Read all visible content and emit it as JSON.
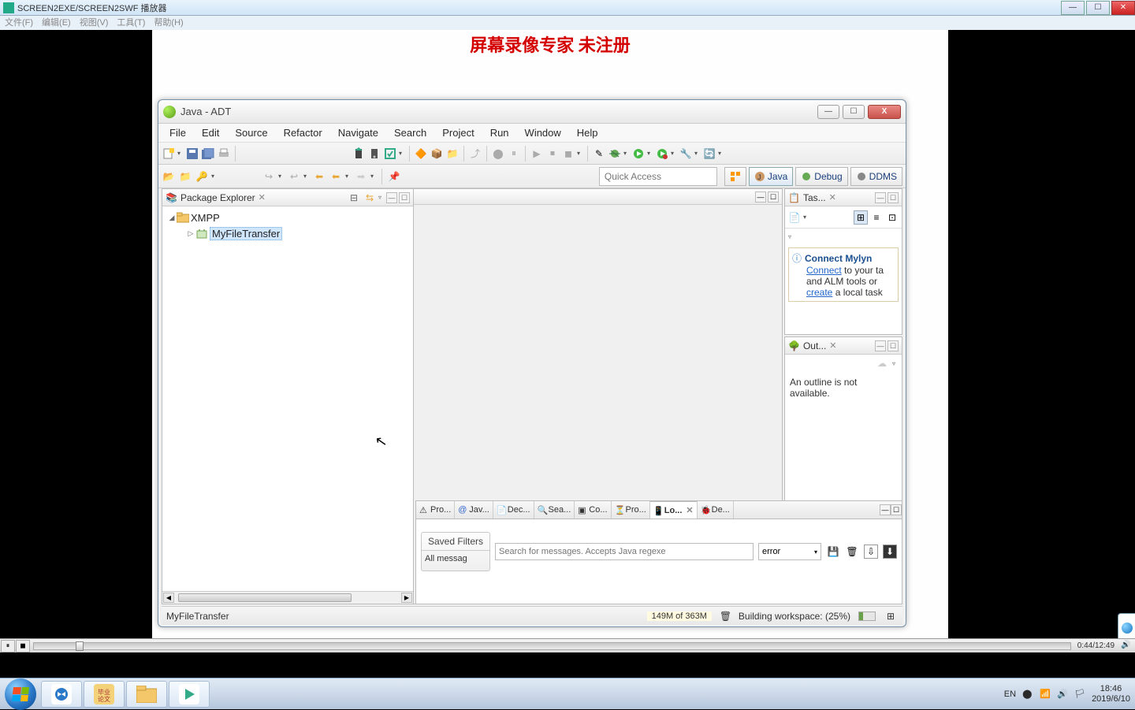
{
  "player": {
    "title": "SCREEN2EXE/SCREEN2SWF 播放器",
    "menubar": "文件(F)　编辑(E)　视图(V)　工具(T)　帮助(H)",
    "time": "0:44/12:49",
    "vol_icon": "volume-icon"
  },
  "watermark": "屏幕录像专家  未注册",
  "eclipse": {
    "title": "Java - ADT",
    "menu": [
      "File",
      "Edit",
      "Source",
      "Refactor",
      "Navigate",
      "Search",
      "Project",
      "Run",
      "Window",
      "Help"
    ],
    "quick_access_placeholder": "Quick Access",
    "perspectives": {
      "java": "Java",
      "debug": "Debug",
      "ddms": "DDMS"
    },
    "views": {
      "package_explorer": "Package Explorer",
      "task": "Tas...",
      "outline": "Out...",
      "outline_msg": "An outline is not available."
    },
    "tree": {
      "root": "XMPP",
      "child": "MyFileTransfer"
    },
    "mylyn": {
      "title": "Connect Mylyn",
      "line1a": "Connect",
      "line1b": " to your ta",
      "line2": "and ALM tools or ",
      "line3a": "create",
      "line3b": " a local task"
    },
    "bottom_tabs": [
      "Pro...",
      "Jav...",
      "Dec...",
      "Sea...",
      "Co...",
      "Pro...",
      "Lo...",
      "De..."
    ],
    "logcat": {
      "saved_filters": "Saved Filters",
      "all_msg": "All messag",
      "search_placeholder": "Search for messages. Accepts Java regexe",
      "level": "error"
    },
    "status": {
      "selection": "MyFileTransfer",
      "memory": "149M of 363M",
      "progress": "Building workspace: (25%)"
    }
  },
  "taskbar": {
    "lang": "EN",
    "time": "18:46",
    "date": "2019/6/10"
  }
}
